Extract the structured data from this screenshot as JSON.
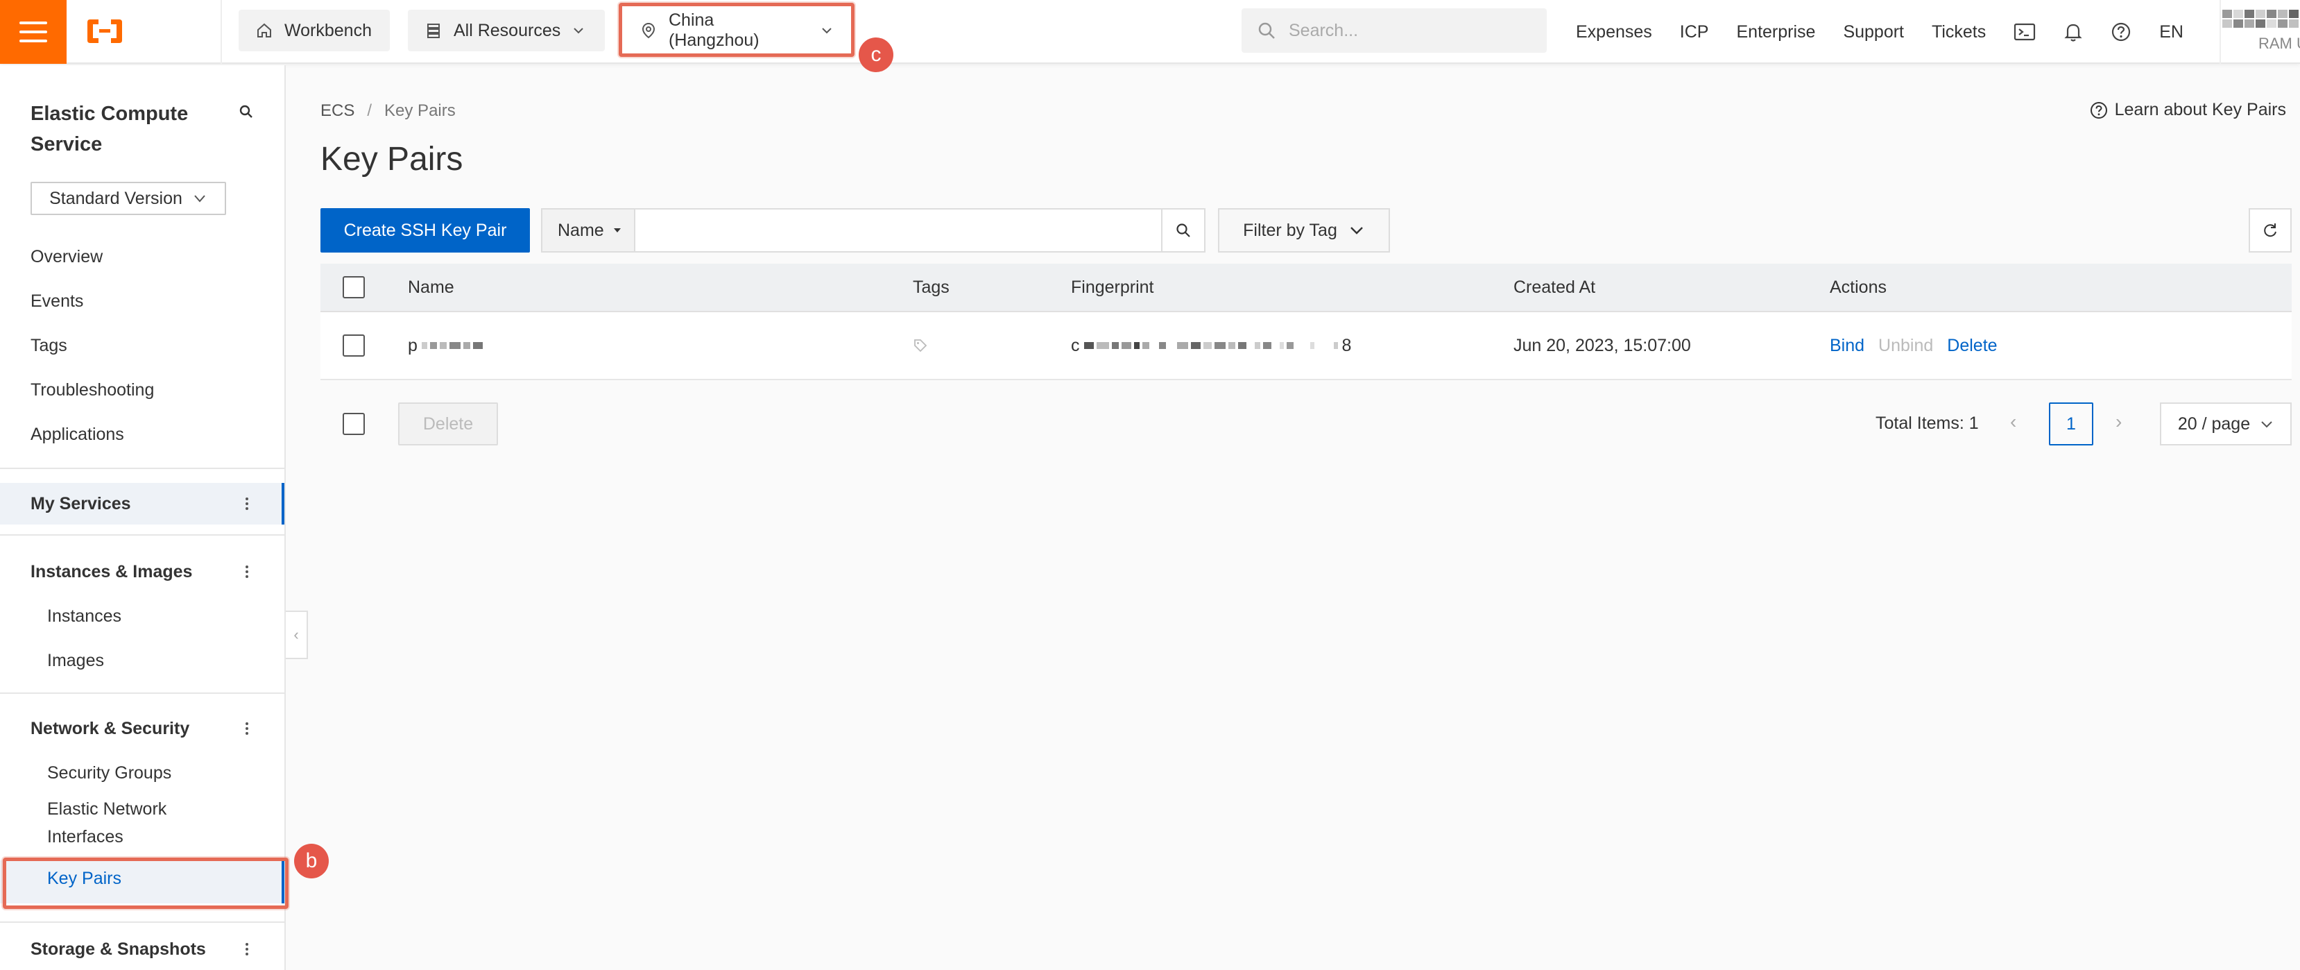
{
  "topbar": {
    "workbench": "Workbench",
    "all_resources": "All Resources",
    "region": "China (Hangzhou)",
    "search_placeholder": "Search...",
    "links": [
      "Expenses",
      "ICP",
      "Enterprise",
      "Support",
      "Tickets"
    ],
    "lang": "EN",
    "user_role": "RAM U"
  },
  "sidebar": {
    "title": "Elastic Compute Service",
    "version": "Standard Version",
    "top_items": [
      "Overview",
      "Events",
      "Tags",
      "Troubleshooting",
      "Applications"
    ],
    "my_services": "My Services",
    "instances_images": {
      "header": "Instances & Images",
      "items": [
        "Instances",
        "Images"
      ]
    },
    "network_security": {
      "header": "Network & Security",
      "items": [
        "Security Groups",
        "Elastic Network Interfaces",
        "Key Pairs"
      ]
    },
    "storage": "Storage & Snapshots"
  },
  "breadcrumb": [
    "ECS",
    "/",
    "Key Pairs"
  ],
  "learn_link": "Learn about Key Pairs",
  "page_title": "Key Pairs",
  "toolbar": {
    "create_button": "Create SSH Key Pair",
    "name_select": "Name",
    "filter_by_tag": "Filter by Tag"
  },
  "table": {
    "headers": [
      "Name",
      "Tags",
      "Fingerprint",
      "Created At",
      "Actions"
    ],
    "rows": [
      {
        "name_prefix": "p",
        "fingerprint_prefix": "c",
        "fingerprint_suffix": "8",
        "created_at": "Jun 20, 2023, 15:07:00",
        "actions": [
          "Bind",
          "Unbind",
          "Delete"
        ]
      }
    ]
  },
  "footer": {
    "delete_button": "Delete",
    "total_items": "Total Items: 1",
    "current_page": "1",
    "page_size": "20 / page"
  },
  "annotations": {
    "b": "b",
    "c": "c"
  },
  "colors": {
    "brand_orange": "#ff6a00",
    "primary_blue": "#0064c8",
    "annotation_red": "#e5574a"
  }
}
